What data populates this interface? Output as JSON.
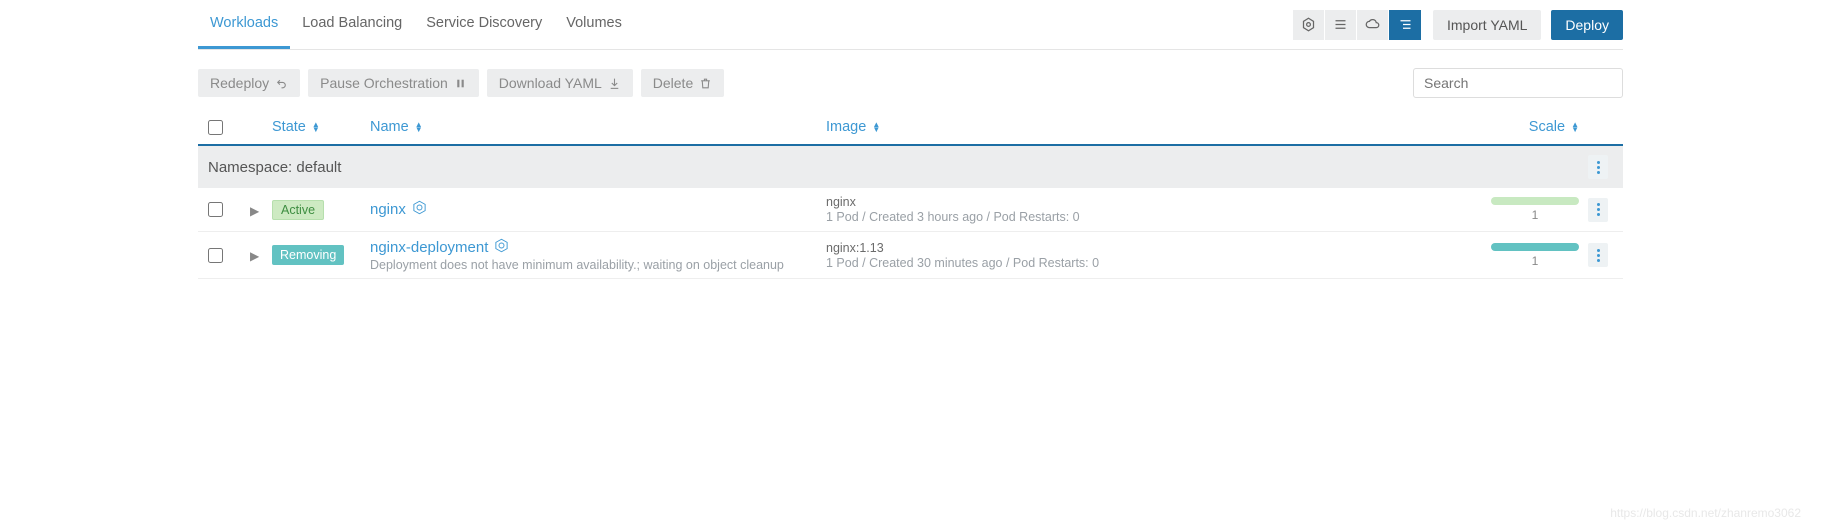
{
  "tabs": {
    "workloads": "Workloads",
    "loadbalancing": "Load Balancing",
    "servicediscovery": "Service Discovery",
    "volumes": "Volumes"
  },
  "topButtons": {
    "importYaml": "Import YAML",
    "deploy": "Deploy"
  },
  "actions": {
    "redeploy": "Redeploy",
    "pause": "Pause Orchestration",
    "download": "Download YAML",
    "delete": "Delete"
  },
  "search": {
    "placeholder": "Search"
  },
  "columns": {
    "state": "State",
    "name": "Name",
    "image": "Image",
    "scale": "Scale"
  },
  "group": {
    "namespaceLabel": "Namespace: default"
  },
  "rows": [
    {
      "state": "Active",
      "stateClass": "active",
      "name": "nginx",
      "nameSub": "",
      "image": "nginx",
      "imageSub": "1 Pod / Created 3 hours ago / Pod Restarts: 0",
      "scaleBar": "green",
      "scaleNum": "1"
    },
    {
      "state": "Removing",
      "stateClass": "removing",
      "name": "nginx-deployment",
      "nameSub": "Deployment does not have minimum availability.; waiting on object cleanup",
      "image": "nginx:1.13",
      "imageSub": "1 Pod / Created 30 minutes ago / Pod Restarts: 0",
      "scaleBar": "teal",
      "scaleNum": "1"
    }
  ],
  "watermark": "https://blog.csdn.net/zhanremo3062"
}
